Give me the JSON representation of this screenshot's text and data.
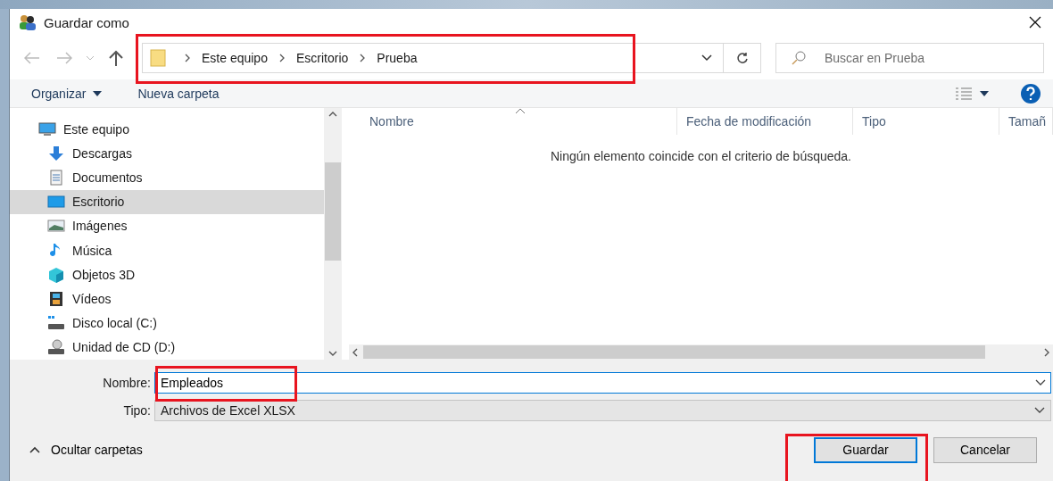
{
  "window": {
    "title": "Guardar como"
  },
  "address_bar": {
    "path": [
      "Este equipo",
      "Escritorio",
      "Prueba"
    ]
  },
  "search": {
    "placeholder": "Buscar en Prueba"
  },
  "toolbar": {
    "organize": "Organizar",
    "new_folder": "Nueva carpeta"
  },
  "sidebar": {
    "items": [
      {
        "label": "Este equipo",
        "kind": "computer",
        "selected": false,
        "children": [
          {
            "label": "Descargas",
            "kind": "downloads",
            "selected": false
          },
          {
            "label": "Documentos",
            "kind": "documents",
            "selected": false
          },
          {
            "label": "Escritorio",
            "kind": "desktop",
            "selected": true
          },
          {
            "label": "Imágenes",
            "kind": "pictures",
            "selected": false
          },
          {
            "label": "Música",
            "kind": "music",
            "selected": false
          },
          {
            "label": "Objetos 3D",
            "kind": "objects",
            "selected": false
          },
          {
            "label": "Vídeos",
            "kind": "videos",
            "selected": false
          },
          {
            "label": "Disco local (C:)",
            "kind": "drive",
            "selected": false
          },
          {
            "label": "Unidad de CD (D:)",
            "kind": "cd",
            "selected": false
          }
        ]
      }
    ]
  },
  "table": {
    "columns": [
      "Nombre",
      "Fecha de modificación",
      "Tipo",
      "Tamañ"
    ],
    "empty_message": "Ningún elemento coincide con el criterio de búsqueda."
  },
  "file_name": {
    "label": "Nombre:",
    "value": "Empleados"
  },
  "file_type": {
    "label": "Tipo:",
    "value": "Archivos de Excel XLSX"
  },
  "hide_folders": "Ocultar carpetas",
  "buttons": [
    {
      "label": "Guardar",
      "default": true
    },
    {
      "label": "Cancelar",
      "default": false
    }
  ]
}
